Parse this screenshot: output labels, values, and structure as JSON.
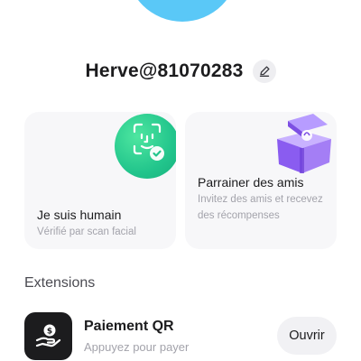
{
  "profile": {
    "username": "Herve@81070283"
  },
  "cards": [
    {
      "title": "Je suis humain",
      "subtitle": "Vérifié par scan facial",
      "icon": "face-scan-icon"
    },
    {
      "title": "Parrainer des amis",
      "subtitle": "Invitez des amis et recevez des récompenses",
      "icon": "gift-box-icon"
    }
  ],
  "extensions": {
    "section_title": "Extensions",
    "items": [
      {
        "name": "Paiement QR",
        "description": "Appuyez pour payer",
        "button_label": "Ouvrir",
        "icon": "qr-payment-icon"
      }
    ]
  },
  "colors": {
    "avatar": "#5ac8f7",
    "face_badge": "#22c58c",
    "gift": "#9b6cf2",
    "card_bg": "#f7f7f9"
  }
}
